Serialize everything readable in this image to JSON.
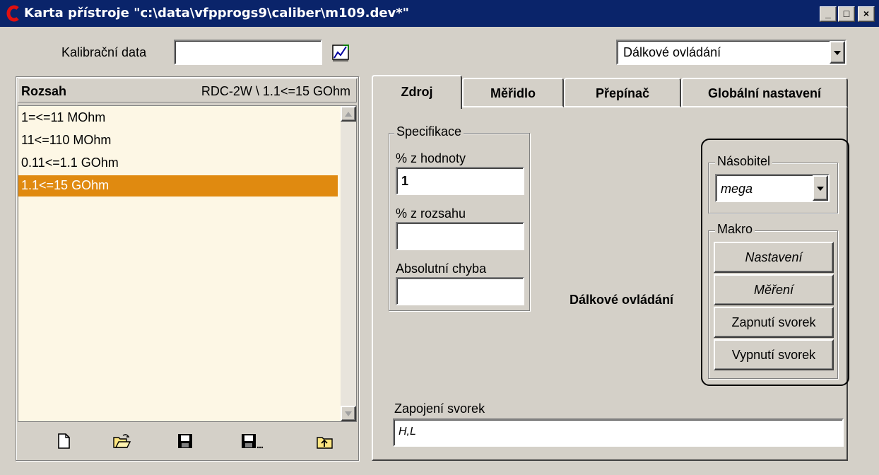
{
  "window": {
    "title": "Karta přístroje \"c:\\data\\vfpprogs9\\caliber\\m109.dev*\"",
    "minimize": "_",
    "maximize": "□",
    "close": "×"
  },
  "top": {
    "kalibracni_label": "Kalibrační data",
    "kalibracni_value": "",
    "mode_selected": "Dálkové ovládání"
  },
  "left": {
    "header_label": "Rozsah",
    "header_value": "RDC-2W \\ 1.1<=15 GOhm",
    "ranges": [
      "1=<=11 MOhm",
      "11<=110 MOhm",
      "0.11<=1.1 GOhm",
      "1.1<=15 GOhm"
    ],
    "selected_index": 3,
    "toolbar": [
      "new-file-icon",
      "open-folder-icon",
      "save-icon",
      "save-as-icon",
      "export-icon"
    ]
  },
  "tabs": [
    "Zdroj",
    "Měřidlo",
    "Přepínač",
    "Globální nastavení"
  ],
  "active_tab": 0,
  "spec": {
    "title": "Specifikace",
    "hodnoty_label": "% z hodnoty",
    "hodnoty_value": "1",
    "rozsahu_label": "% z rozsahu",
    "rozsahu_value": "",
    "absolutni_label": "Absolutní chyba",
    "absolutni_value": ""
  },
  "remote": {
    "label": "Dálkové ovládání",
    "nasobitel_title": "Násobitel",
    "nasobitel_value": "mega",
    "makro_title": "Makro",
    "makro_buttons": [
      "Nastavení",
      "Měření",
      "Zapnutí svorek",
      "Vypnutí svorek"
    ]
  },
  "zapojeni": {
    "label": "Zapojení svorek",
    "value": "H,L"
  },
  "colors": {
    "titlebar": "#0a246a",
    "selection": "#e08a10",
    "face": "#d4d0c8"
  }
}
